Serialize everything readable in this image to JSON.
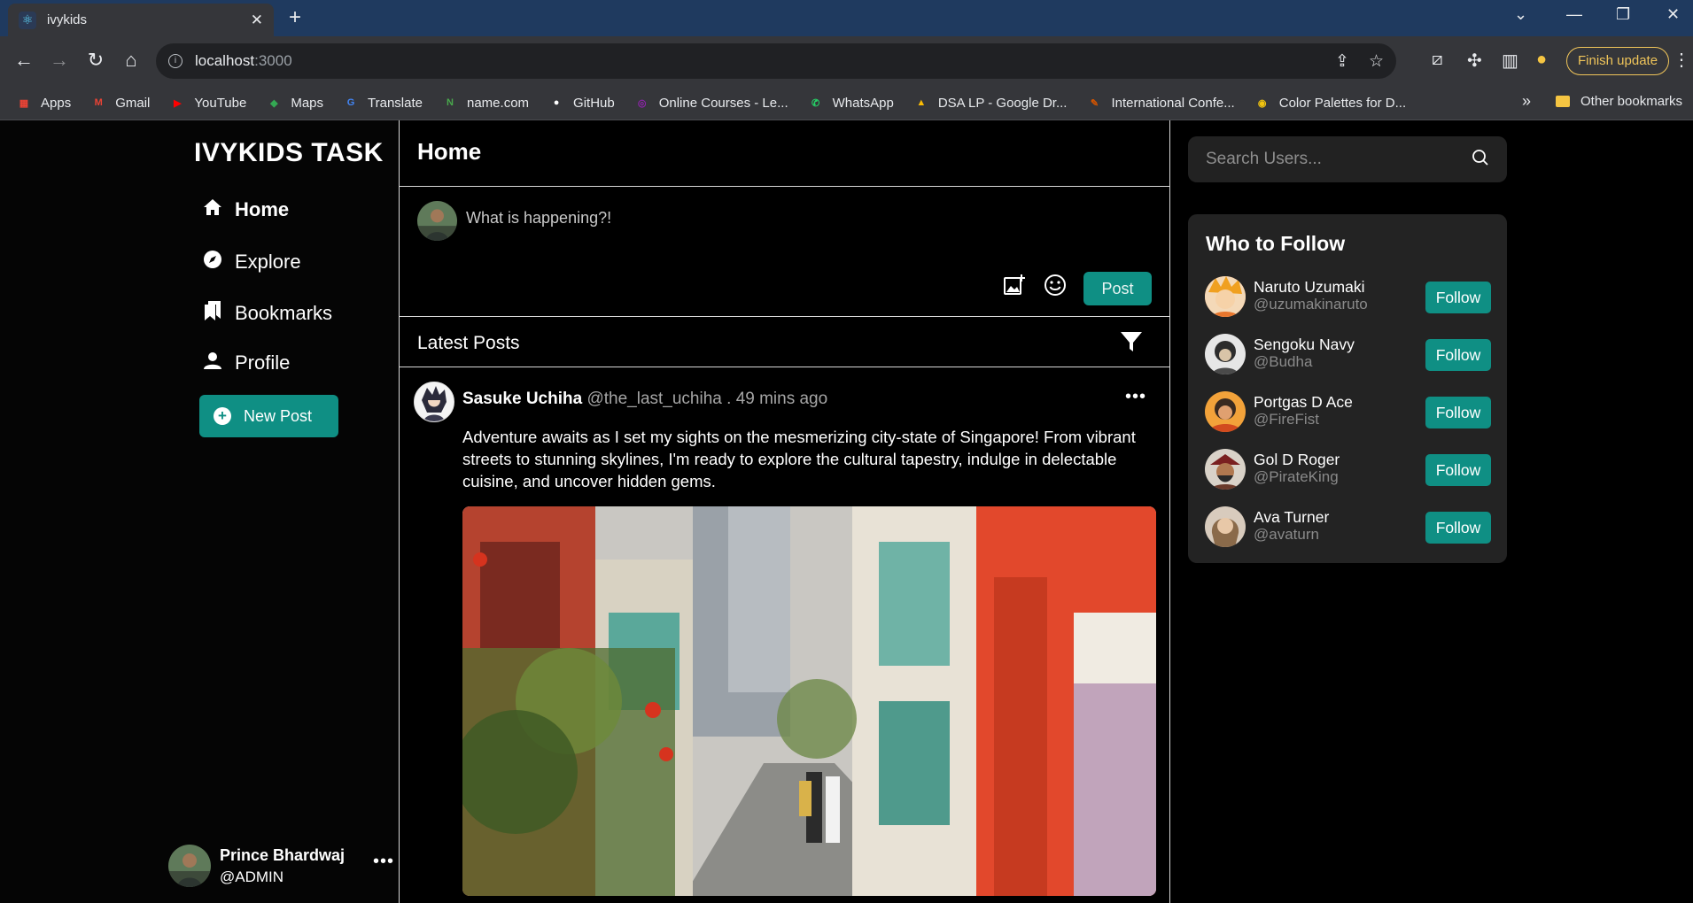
{
  "browser": {
    "tab_title": "ivykids",
    "url_host": "localhost",
    "url_port": ":3000",
    "finish_update_label": "Finish update",
    "bookmarks": [
      {
        "label": "Apps",
        "icon": "apps-grid-icon",
        "color": "#ea4335"
      },
      {
        "label": "Gmail",
        "icon": "gmail-icon",
        "color": "#ea4335"
      },
      {
        "label": "YouTube",
        "icon": "youtube-icon",
        "color": "#ff0000"
      },
      {
        "label": "Maps",
        "icon": "maps-icon",
        "color": "#34a853"
      },
      {
        "label": "Translate",
        "icon": "translate-icon",
        "color": "#4285f4"
      },
      {
        "label": "name.com",
        "icon": "namecom-icon",
        "color": "#49a84c"
      },
      {
        "label": "GitHub",
        "icon": "github-icon",
        "color": "#ffffff"
      },
      {
        "label": "Online Courses - Le...",
        "icon": "courses-icon",
        "color": "#8e24aa"
      },
      {
        "label": "WhatsApp",
        "icon": "whatsapp-icon",
        "color": "#25d366"
      },
      {
        "label": "DSA LP - Google Dr...",
        "icon": "google-drive-icon",
        "color": "#fbbc04"
      },
      {
        "label": "International Confe...",
        "icon": "conference-icon",
        "color": "#d35400"
      },
      {
        "label": "Color Palettes for D...",
        "icon": "palette-icon",
        "color": "#f1c40f"
      }
    ],
    "other_bookmarks_label": "Other bookmarks"
  },
  "sidebar": {
    "brand": "IVYKIDS TASK",
    "items": [
      {
        "label": "Home",
        "icon": "home-icon"
      },
      {
        "label": "Explore",
        "icon": "compass-icon"
      },
      {
        "label": "Bookmarks",
        "icon": "bookmarks-icon"
      },
      {
        "label": "Profile",
        "icon": "person-icon"
      }
    ],
    "new_post_label": "New Post",
    "current_user": {
      "name": "Prince Bhardwaj",
      "handle": "@ADMIN"
    }
  },
  "main": {
    "title": "Home",
    "composer": {
      "placeholder": "What is happening?!",
      "post_label": "Post"
    },
    "feed_title": "Latest Posts",
    "posts": [
      {
        "author": "Sasuke Uchiha",
        "handle": "@the_last_uchiha",
        "separator": ".",
        "time": "49 mins ago",
        "body": "Adventure awaits as I set my sights on the mesmerizing city-state of Singapore! From vibrant streets to stunning skylines, I'm ready to explore the cultural tapestry, indulge in delectable cuisine, and uncover hidden gems."
      }
    ]
  },
  "right": {
    "search_placeholder": "Search Users...",
    "who_to_follow_title": "Who to Follow",
    "follow_label": "Follow",
    "suggestions": [
      {
        "name": "Naruto Uzumaki",
        "handle": "@uzumakinaruto",
        "color": "#e8772e"
      },
      {
        "name": "Sengoku Navy",
        "handle": "@Budha",
        "color": "#6b6b6b"
      },
      {
        "name": "Portgas D Ace",
        "handle": "@FireFist",
        "color": "#e0812b"
      },
      {
        "name": "Gol D Roger",
        "handle": "@PirateKing",
        "color": "#7a4a3a"
      },
      {
        "name": "Ava Turner",
        "handle": "@avaturn",
        "color": "#b89a80"
      }
    ]
  },
  "colors": {
    "accent": "#0f8f84",
    "panel": "#232323",
    "background": "#000000"
  }
}
